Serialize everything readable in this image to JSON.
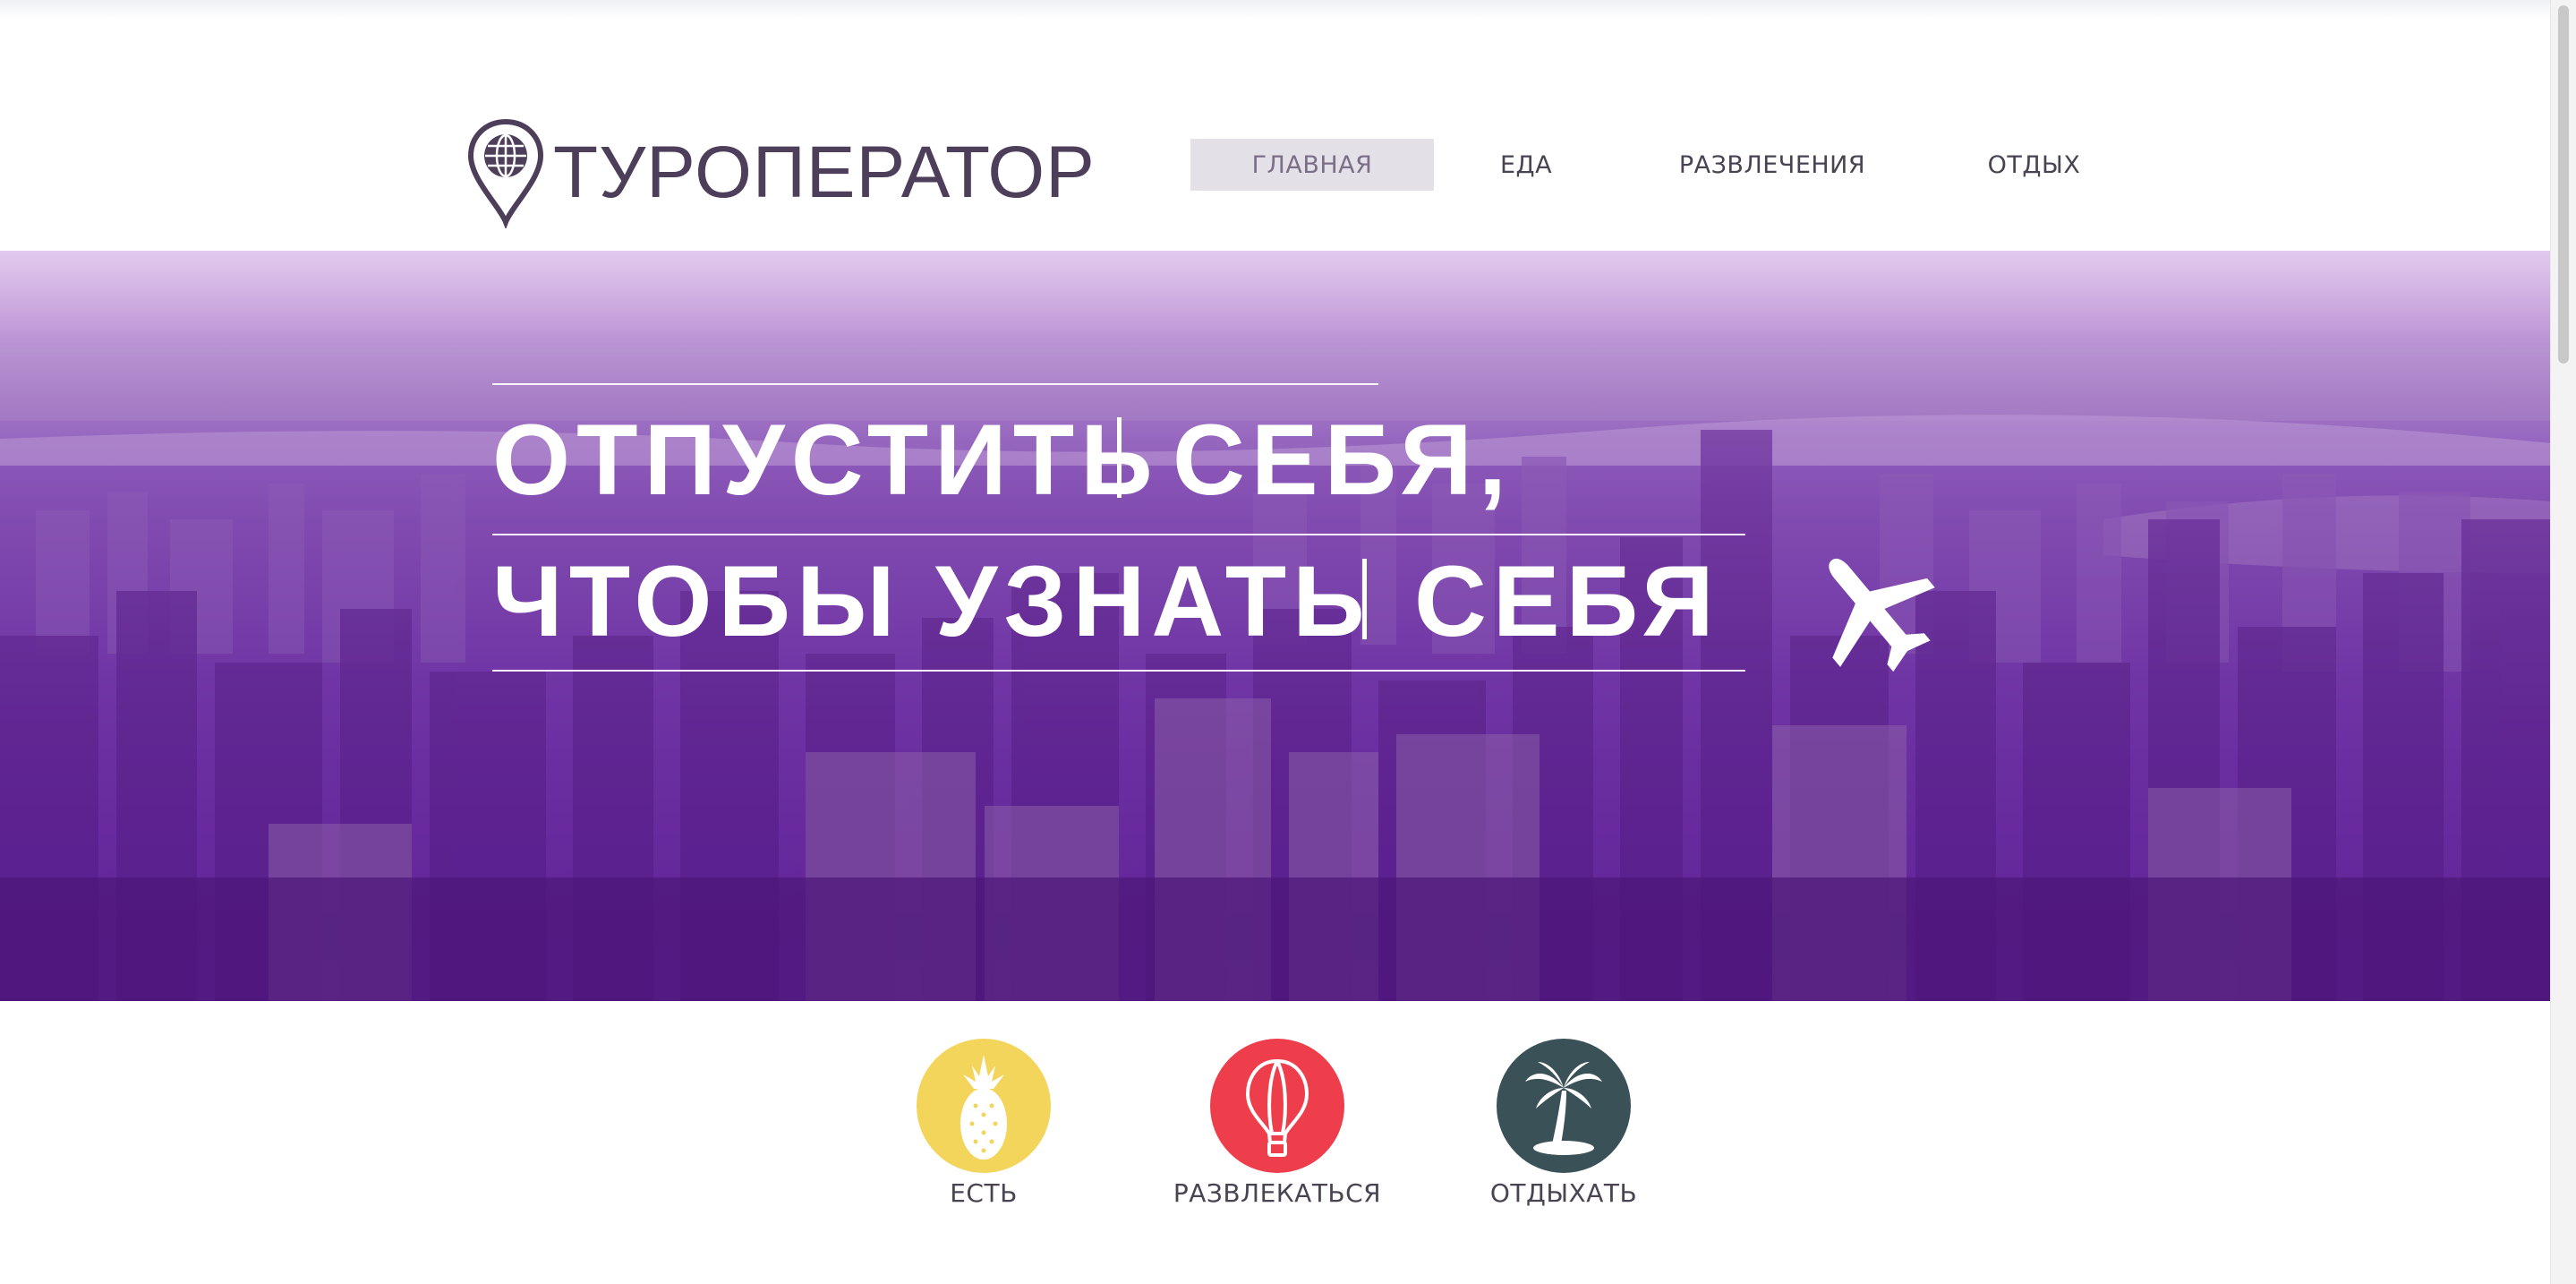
{
  "brand": {
    "name": "ТУРОПЕРАТОР",
    "color": "#4d3e5a"
  },
  "nav": {
    "items": [
      {
        "label": "ГЛАВНАЯ",
        "active": true
      },
      {
        "label": "ЕДА",
        "active": false
      },
      {
        "label": "РАЗВЛЕЧЕНИЯ",
        "active": false
      },
      {
        "label": "ОТДЫХ",
        "active": false
      }
    ]
  },
  "hero": {
    "line1_a": "ОТПУСТИТЬ",
    "line1_b": "СЕБЯ,",
    "line2_a": "ЧТОБЫ УЗНАТЬ",
    "line2_b": "СЕБЯ",
    "icon": "airplane-icon",
    "tint": "#6d2fa6"
  },
  "categories": [
    {
      "label": "ЕСТЬ",
      "icon": "pineapple-icon",
      "color": "#f2d55a"
    },
    {
      "label": "РАЗВЛЕКАТЬСЯ",
      "icon": "hot-air-balloon-icon",
      "color": "#ee3d4b"
    },
    {
      "label": "ОТДЫХАТЬ",
      "icon": "palm-tree-icon",
      "color": "#3a5257"
    }
  ]
}
